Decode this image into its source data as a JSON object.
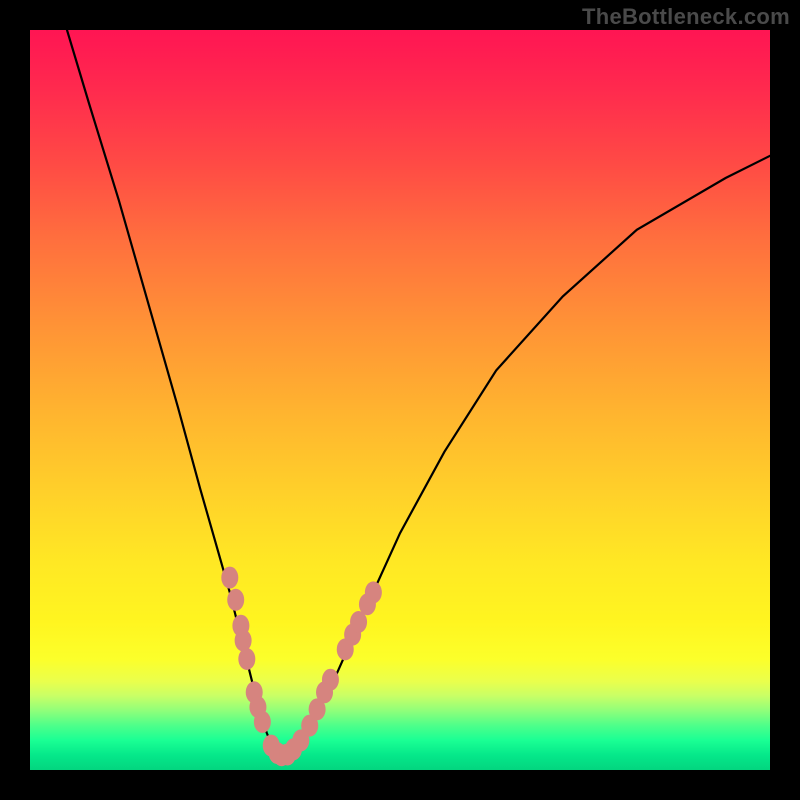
{
  "watermark": "TheBottleneck.com",
  "chart_data": {
    "type": "line",
    "title": "",
    "xlabel": "",
    "ylabel": "",
    "xlim": [
      0,
      100
    ],
    "ylim": [
      0,
      100
    ],
    "grid": false,
    "legend": false,
    "series": [
      {
        "name": "curve",
        "x": [
          5,
          8,
          12,
          16,
          20,
          23,
          25,
          27,
          28.5,
          30,
          31,
          32,
          32.8,
          33.5,
          34,
          35,
          36,
          38,
          41,
          45,
          50,
          56,
          63,
          72,
          82,
          94,
          100
        ],
        "y": [
          100,
          90,
          77,
          63,
          49,
          38,
          31,
          24,
          18,
          12,
          8,
          5,
          3,
          2.2,
          2,
          2.2,
          3.2,
          6,
          12,
          21,
          32,
          43,
          54,
          64,
          73,
          80,
          83
        ],
        "color": "#000000"
      }
    ],
    "marker_points": {
      "name": "dots",
      "color": "#d6847f",
      "points": [
        {
          "x": 27.0,
          "y": 26.0
        },
        {
          "x": 27.8,
          "y": 23.0
        },
        {
          "x": 28.5,
          "y": 19.5
        },
        {
          "x": 28.8,
          "y": 17.5
        },
        {
          "x": 29.3,
          "y": 15.0
        },
        {
          "x": 30.3,
          "y": 10.5
        },
        {
          "x": 30.8,
          "y": 8.5
        },
        {
          "x": 31.4,
          "y": 6.5
        },
        {
          "x": 32.6,
          "y": 3.3
        },
        {
          "x": 33.4,
          "y": 2.3
        },
        {
          "x": 34.0,
          "y": 2.0
        },
        {
          "x": 34.8,
          "y": 2.1
        },
        {
          "x": 35.6,
          "y": 2.8
        },
        {
          "x": 36.6,
          "y": 4.0
        },
        {
          "x": 37.8,
          "y": 6.0
        },
        {
          "x": 38.8,
          "y": 8.2
        },
        {
          "x": 39.8,
          "y": 10.5
        },
        {
          "x": 40.6,
          "y": 12.2
        },
        {
          "x": 42.6,
          "y": 16.3
        },
        {
          "x": 43.6,
          "y": 18.3
        },
        {
          "x": 44.4,
          "y": 20.0
        },
        {
          "x": 45.6,
          "y": 22.4
        },
        {
          "x": 46.4,
          "y": 24.0
        }
      ]
    },
    "gradient_stops": [
      {
        "pos": 0.0,
        "color": "#ff1553"
      },
      {
        "pos": 0.18,
        "color": "#ff4a45"
      },
      {
        "pos": 0.4,
        "color": "#ff9336"
      },
      {
        "pos": 0.64,
        "color": "#ffd429"
      },
      {
        "pos": 0.8,
        "color": "#fff520"
      },
      {
        "pos": 0.9,
        "color": "#c8ff66"
      },
      {
        "pos": 0.96,
        "color": "#1aff94"
      },
      {
        "pos": 1.0,
        "color": "#03d57f"
      }
    ]
  }
}
